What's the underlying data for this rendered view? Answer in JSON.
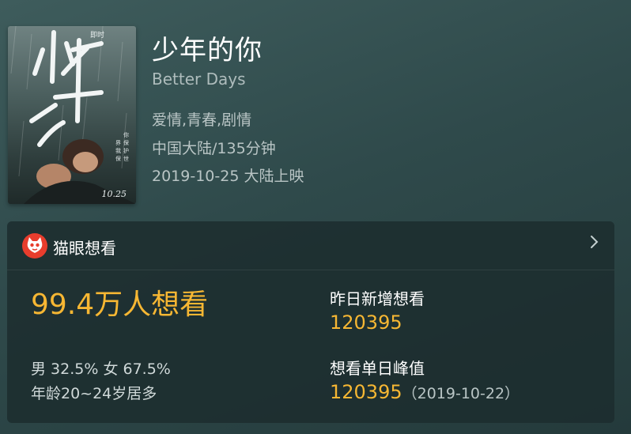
{
  "movie": {
    "title": "少年的你",
    "subtitle": "Better Days",
    "genres": "爱情,青春,剧情",
    "origin_duration": "中国大陆/135分钟",
    "release": "2019-10-25 大陆上映"
  },
  "poster": {
    "date_text": "10.25",
    "title_lettering": "少年的你"
  },
  "card": {
    "header_label": "猫眼想看",
    "want_count": "99.4万人想看",
    "gender_ratio": "男 32.5% 女 67.5%",
    "age_group": "年龄20~24岁居多",
    "yesterday_label": "昨日新增想看",
    "yesterday_value": "120395",
    "peak_label": "想看单日峰值",
    "peak_value": "120395",
    "peak_date": "（2019-10-22）"
  },
  "colors": {
    "accent": "#f7b733",
    "maoyan_red": "#e83d2d"
  },
  "icons": [
    "maoyan-cat-icon",
    "chevron-right-icon"
  ]
}
